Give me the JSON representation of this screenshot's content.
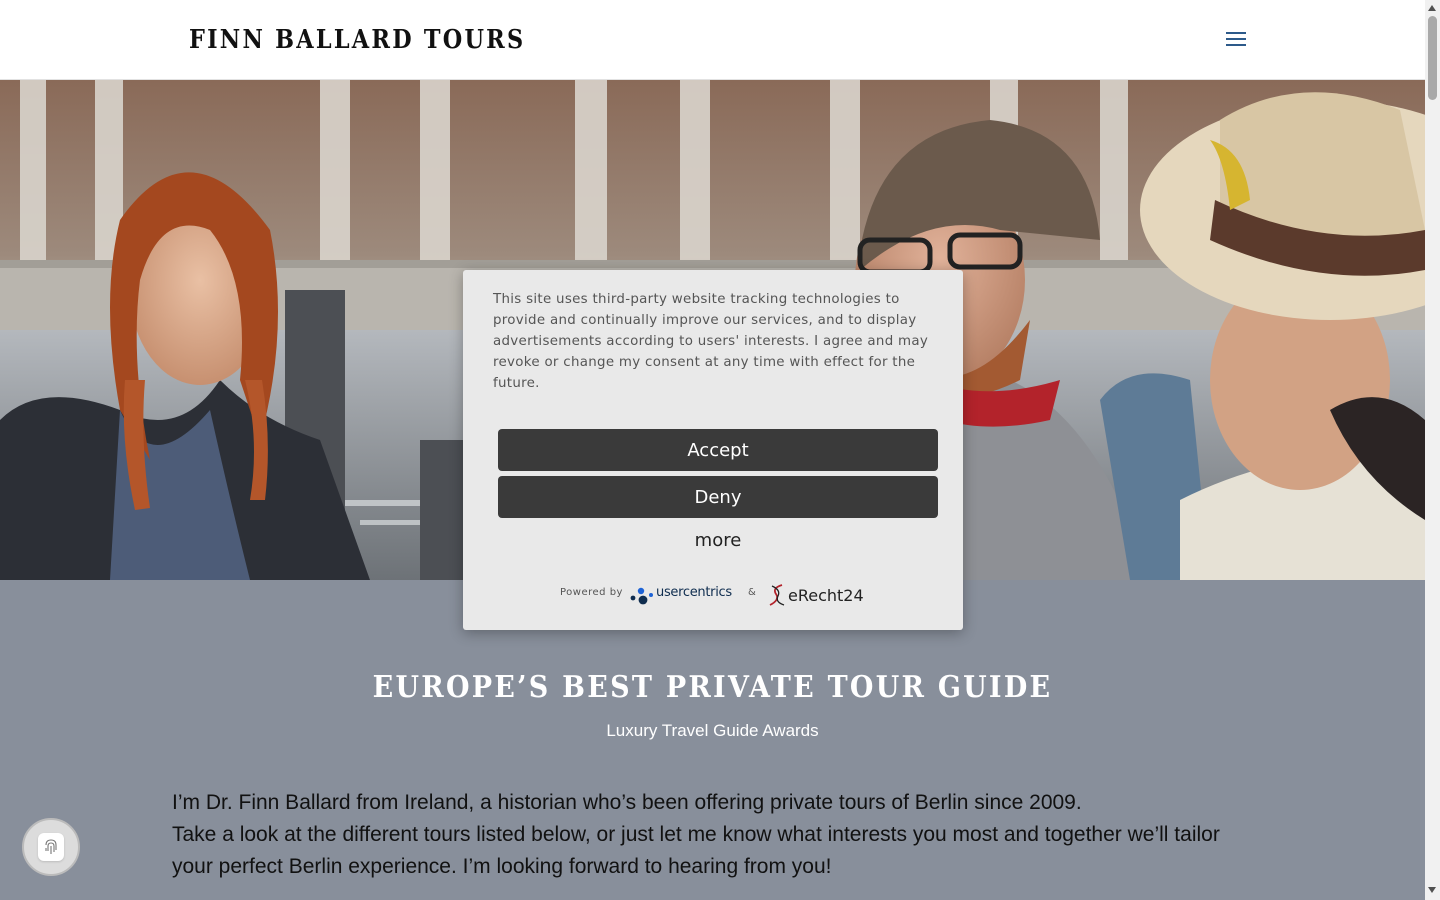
{
  "header": {
    "logo_text": "FINN BALLARD TOURS",
    "menu_icon": "hamburger-menu-icon",
    "menu_color": "#2d5a8a"
  },
  "hero": {
    "image": "photo-of-tour-guide-with-guests-by-museum-colonnade"
  },
  "section": {
    "title": "EUROPE’S BEST PRIVATE TOUR GUIDE",
    "subtitle": "Luxury Travel Guide Awards",
    "paragraph1": "I’m Dr. Finn Ballard from Ireland, a historian who’s been offering private tours of Berlin since 2009.",
    "paragraph2": "Take a look at the different tours listed below, or just let me know what interests you most and together we’ll tailor your perfect Berlin experience. I’m looking forward to hearing from you!",
    "background_color": "#888f9b"
  },
  "consent": {
    "text": "This site uses third-party website tracking technologies to provide and continually improve our services, and to display advertisements according to users' interests. I agree and may revoke or change my consent at any time with effect for the future.",
    "accept_label": "Accept",
    "deny_label": "Deny",
    "more_label": "more",
    "powered_by": "Powered by",
    "usercentrics": "usercentrics",
    "ampersand": "&",
    "erecht": "eRecht24",
    "button_color": "#3a3a3a"
  },
  "privacy_button": {
    "icon": "fingerprint-icon"
  }
}
